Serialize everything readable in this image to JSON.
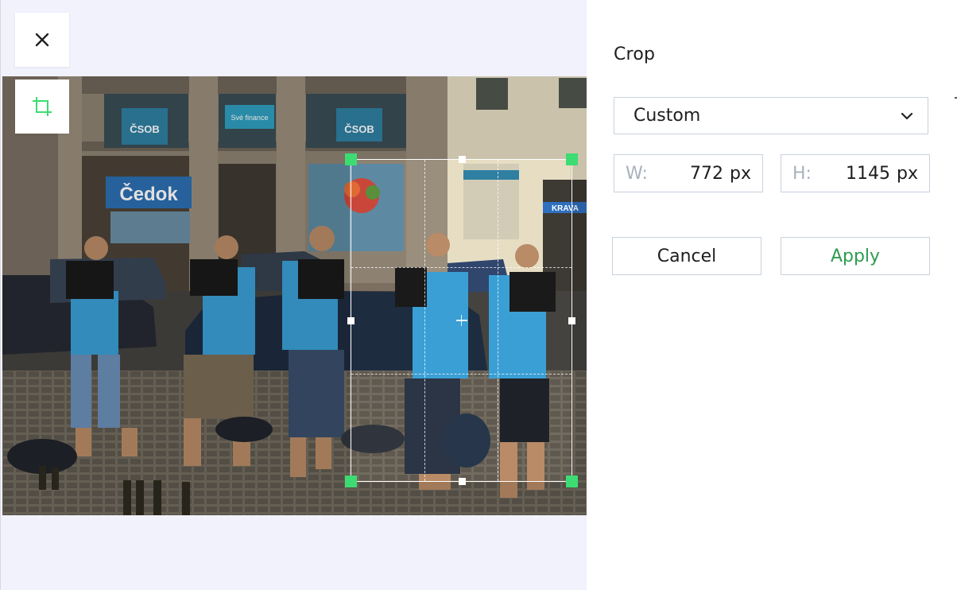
{
  "toolbar": {
    "close_icon": "close-icon",
    "crop_icon": "crop-icon",
    "accent_color": "#3ddc72"
  },
  "photo": {
    "storefront_signs": [
      "CSOB",
      "Své finance",
      "Čedok",
      "KRAVA"
    ]
  },
  "crop_panel": {
    "title": "Crop",
    "aspect_select": {
      "value": "Custom",
      "icon": "chevron-down-icon"
    },
    "width_field": {
      "label": "W:",
      "value": "772",
      "unit": "px"
    },
    "height_field": {
      "label": "H:",
      "value": "1145",
      "unit": "px"
    },
    "cancel_label": "Cancel",
    "apply_label": "Apply",
    "apply_color": "#2e9b4f"
  }
}
